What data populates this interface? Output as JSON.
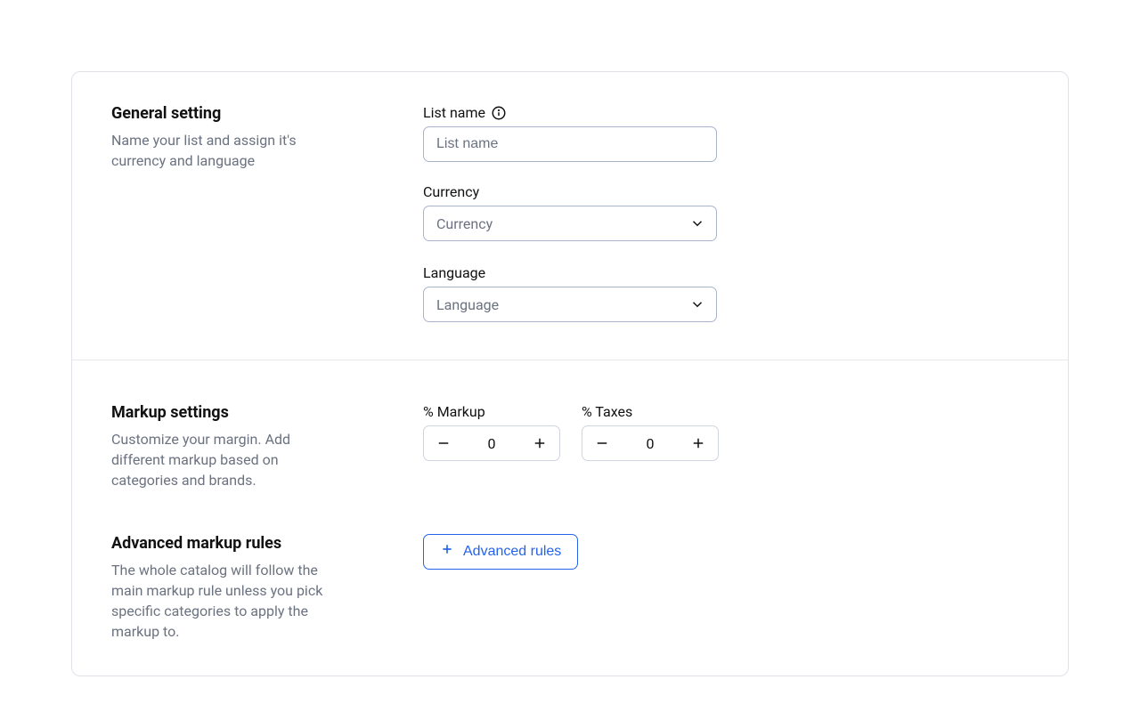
{
  "general": {
    "title": "General setting",
    "desc": "Name your list and assign it's currency and language",
    "listName": {
      "label": "List name",
      "placeholder": "List name",
      "value": ""
    },
    "currency": {
      "label": "Currency",
      "placeholder": "Currency"
    },
    "language": {
      "label": "Language",
      "placeholder": "Language"
    }
  },
  "markup": {
    "title": "Markup settings",
    "desc": "Customize your margin. Add different markup based on categories and brands.",
    "pctMarkup": {
      "label": "% Markup",
      "value": "0"
    },
    "pctTaxes": {
      "label": "% Taxes",
      "value": "0"
    }
  },
  "advanced": {
    "title": "Advanced markup rules",
    "desc": "The whole catalog will follow the main markup rule unless you pick specific categories to apply the markup to.",
    "button": "Advanced rules"
  }
}
